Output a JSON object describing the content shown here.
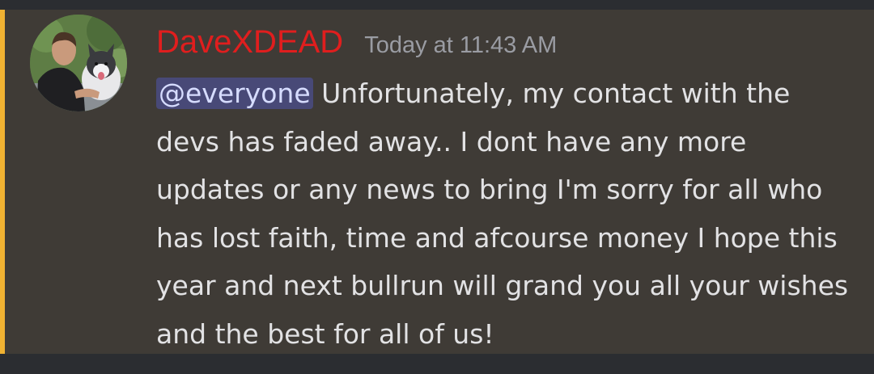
{
  "message": {
    "author": "DaveXDEAD",
    "timestamp": "Today at 11:43 AM",
    "mention": "@everyone",
    "body": " Unfortunately, my contact with the devs has faded away.. I dont have any more updates or any news to bring I'm sorry for all who has lost faith, time and afcourse money I hope this year and next bullrun will grand you all your wishes and the best for all of us!"
  },
  "colors": {
    "username": "#e01e1e",
    "mention_bar": "#f0b232",
    "message_bg": "#3f3b36",
    "app_bg": "#2b2d31"
  },
  "icons": {
    "avatar": "user-photo-with-dog"
  }
}
